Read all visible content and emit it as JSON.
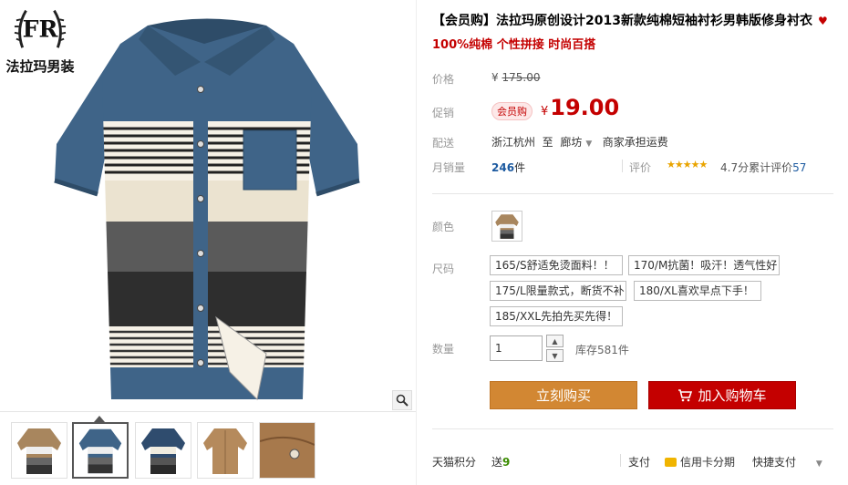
{
  "brand": {
    "monogram": "FR",
    "name": "法拉玛男装"
  },
  "product": {
    "title": "【会员购】法拉玛原创设计2013新款纯棉短袖衬衫男韩版修身衬衣",
    "subtitle": "100%纯棉 个性拼接 时尚百搭",
    "price_label": "价格",
    "price_currency": "¥",
    "price_original": "175.00",
    "promo_label": "促销",
    "promo_badge": "会员购",
    "promo_currency": "¥",
    "promo_price": "19.00",
    "ship_label": "配送",
    "ship_from": "浙江杭州",
    "ship_to_word": "至",
    "ship_to": "廊坊",
    "ship_fee": "商家承担运费",
    "sales_label": "月销量",
    "sales_count": "246",
    "sales_unit": "件",
    "rating_label": "评价",
    "rating_score": "4.7分",
    "rating_total_label": "累计评价",
    "rating_count": "57",
    "color_label": "颜色",
    "size_label": "尺码",
    "sizes": [
      "165/S舒适免烫面料！！",
      "170/M抗菌！吸汗！透气性好",
      "175/L限量款式，断货不补",
      "180/XL喜欢早点下手！",
      "185/XXL先拍先买先得！"
    ],
    "qty_label": "数量",
    "qty_value": "1",
    "stock": "库存581件",
    "buy_label": "立刻购买",
    "cart_label": "加入购物车"
  },
  "footer": {
    "points_label": "天猫积分",
    "points_give": "送",
    "points_value": "9",
    "pay_label": "支付",
    "pay_card": "信用卡分期",
    "pay_quick": "快捷支付"
  },
  "colors": {
    "accent_red": "#c40000",
    "buy_orange": "#d28733",
    "link_blue": "#1c5aa0"
  }
}
